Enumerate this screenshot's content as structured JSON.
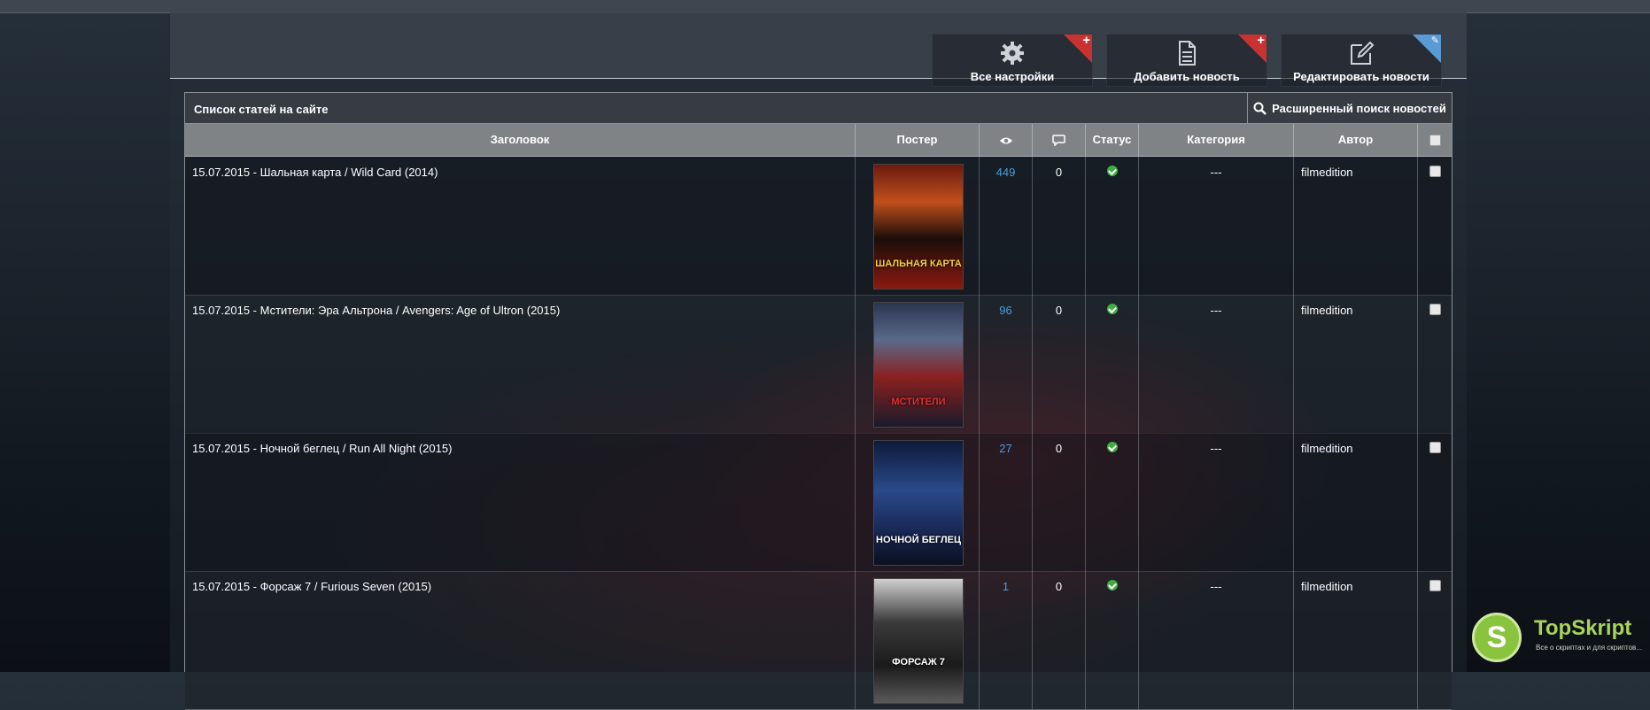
{
  "toolbar": {
    "all_settings": "Все настройки",
    "add_news": "Добавить новость",
    "edit_news": "Редактировать новости"
  },
  "list": {
    "title": "Список статей на сайте",
    "advanced_search": "Расширенный поиск новостей"
  },
  "columns": {
    "title": "Заголовок",
    "poster": "Постер",
    "views_icon": "eye-icon",
    "comments_icon": "comment-icon",
    "status": "Статус",
    "category": "Категория",
    "author": "Автор"
  },
  "rows": [
    {
      "title": "15.07.2015 - Шальная карта / Wild Card (2014)",
      "poster_caption": "ШАЛЬНАЯ КАРТА",
      "views": "449",
      "comments": "0",
      "category": "---",
      "author": "filmedition"
    },
    {
      "title": "15.07.2015 - Мстители: Эра Альтрона / Avengers: Age of Ultron (2015)",
      "poster_caption": "МСТИТЕЛИ",
      "views": "96",
      "comments": "0",
      "category": "---",
      "author": "filmedition"
    },
    {
      "title": "15.07.2015 - Ночной беглец / Run All Night (2015)",
      "poster_caption": "НОЧНОЙ БЕГЛЕЦ",
      "views": "27",
      "comments": "0",
      "category": "---",
      "author": "filmedition"
    },
    {
      "title": "15.07.2015 - Форсаж 7 / Furious Seven (2015)",
      "poster_caption": "ФОРСАЖ 7",
      "views": "1",
      "comments": "0",
      "category": "---",
      "author": "filmedition"
    }
  ],
  "watermark": {
    "name": "TopSkript",
    "letter": "S",
    "tagline": "Все о скриптах и для скриптов..."
  },
  "colors": {
    "views_link": "#4a9ee0",
    "status_ok": "#3fae3f",
    "corner_add": "#c83232",
    "corner_edit": "#5a9bd5"
  }
}
